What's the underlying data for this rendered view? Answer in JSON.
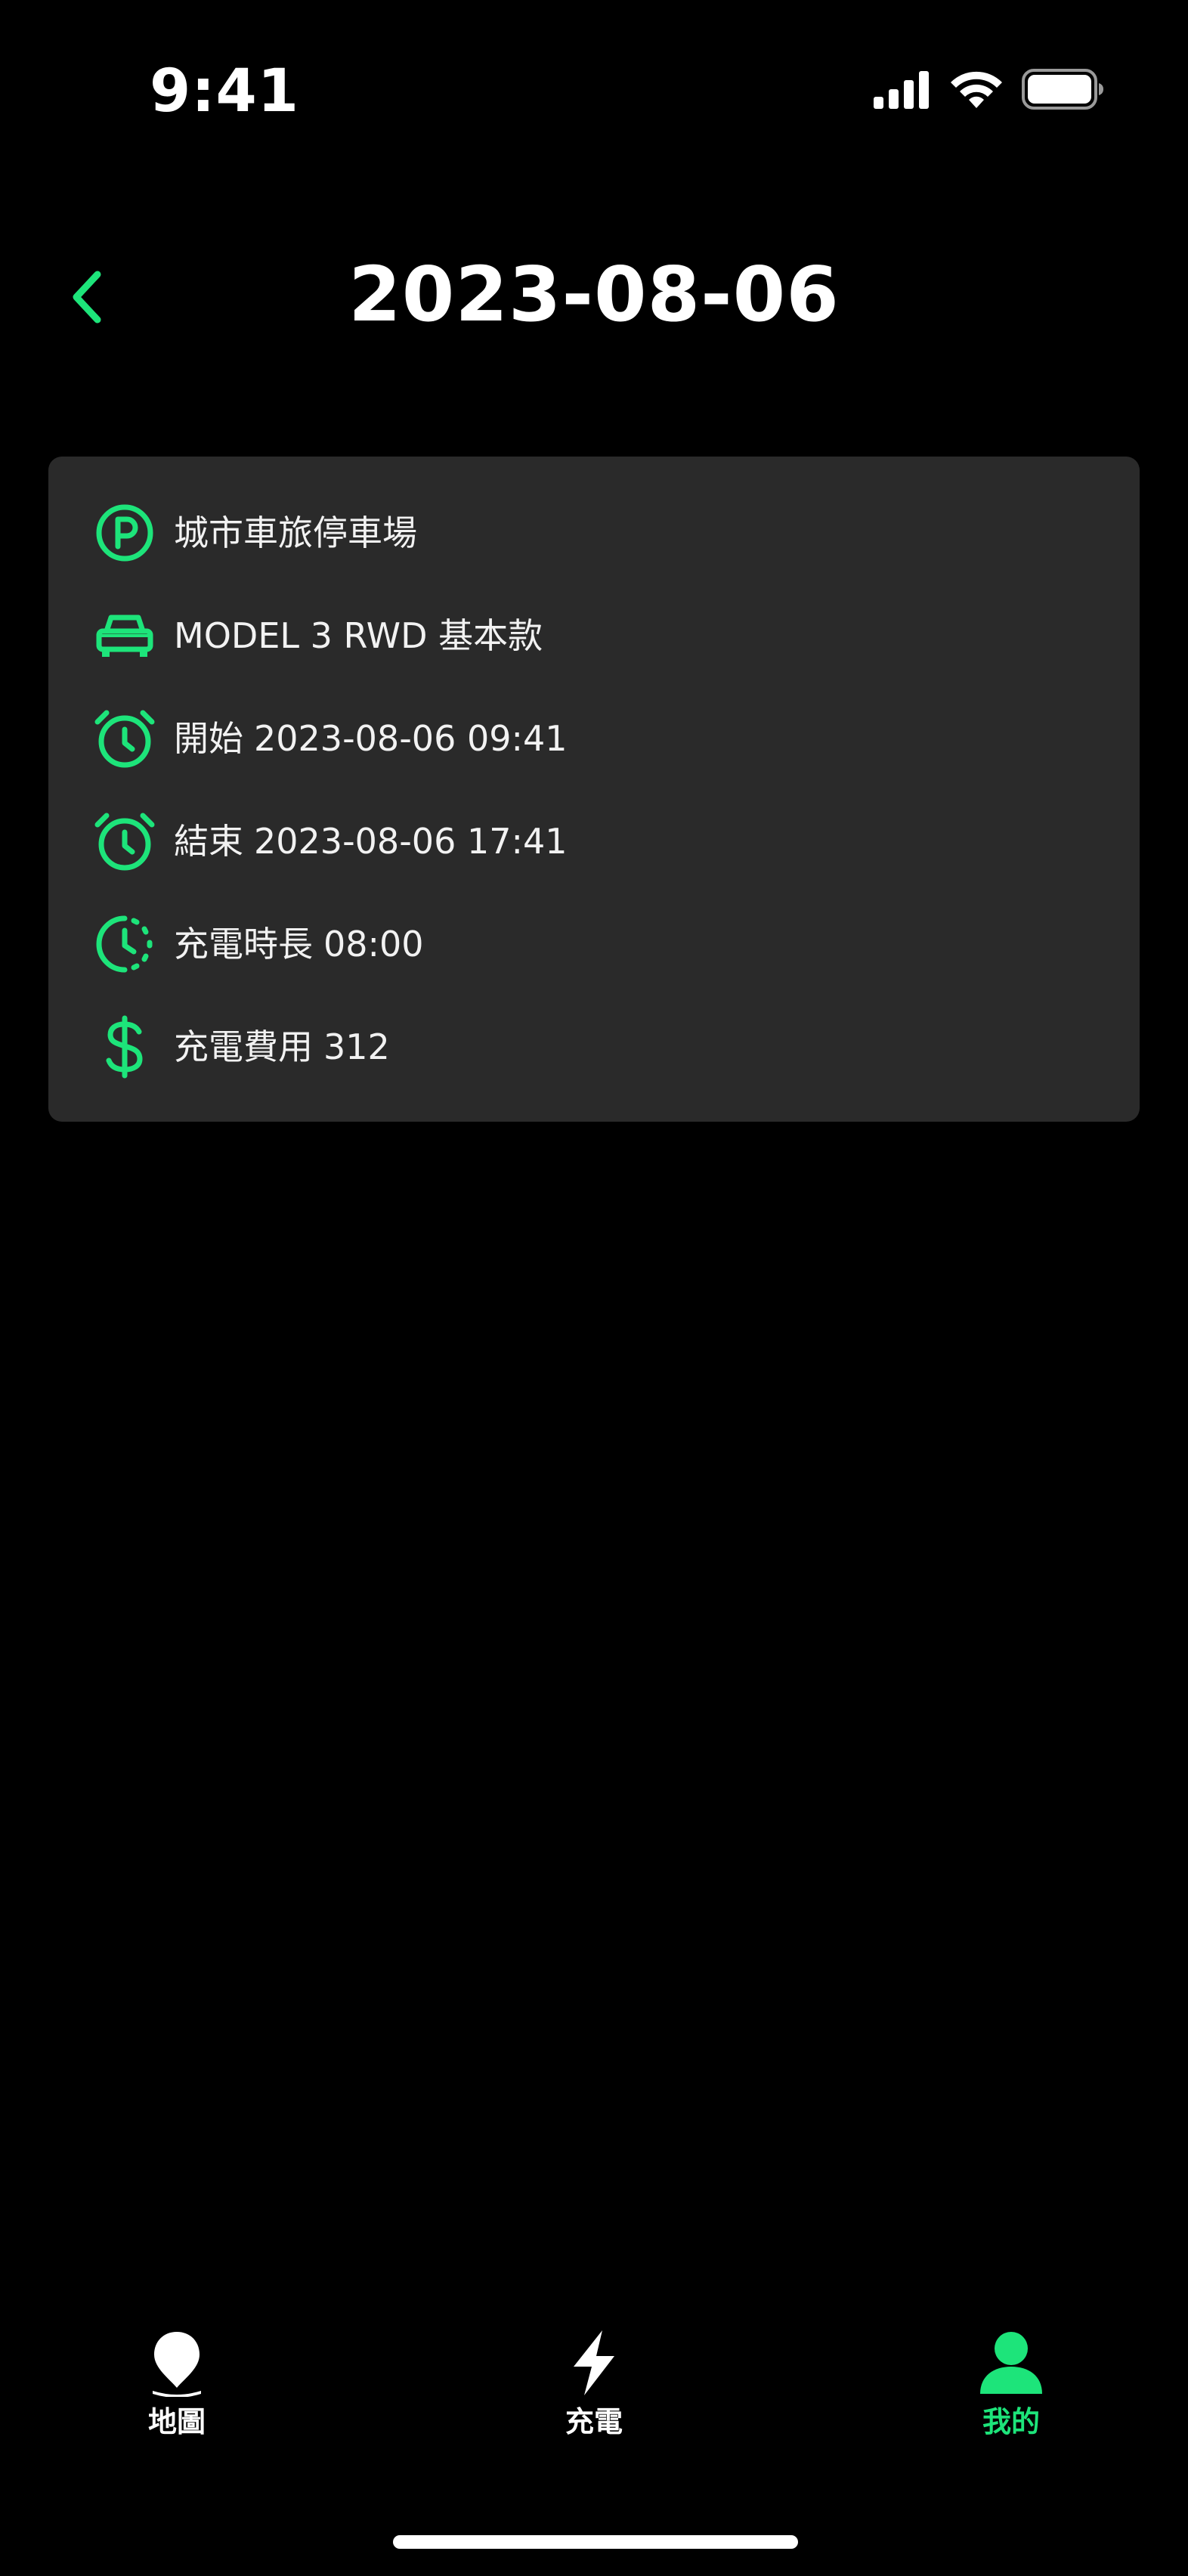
{
  "status_bar": {
    "time": "9:41"
  },
  "header": {
    "title": "2023-08-06",
    "back_icon": "chevron-left-icon"
  },
  "colors": {
    "accent": "#1de47a",
    "card_bg": "#2a2a2a",
    "background": "#000000",
    "text": "#ffffff"
  },
  "details": {
    "station": {
      "icon": "parking-icon",
      "text": "城市車旅停車場"
    },
    "vehicle": {
      "icon": "car-icon",
      "text": "MODEL 3 RWD 基本款"
    },
    "start": {
      "icon": "alarm-clock-icon",
      "label": "開始",
      "value": "2023-08-06 09:41"
    },
    "end": {
      "icon": "alarm-clock-icon",
      "label": "結束",
      "value": "2023-08-06 17:41"
    },
    "duration": {
      "icon": "clock-duration-icon",
      "label": "充電時長",
      "value": "08:00"
    },
    "cost": {
      "icon": "dollar-icon",
      "label": "充電費用",
      "value": "312"
    }
  },
  "tab_bar": {
    "tabs": [
      {
        "label": "地圖",
        "icon": "map-pin-icon",
        "active": false
      },
      {
        "label": "充電",
        "icon": "lightning-icon",
        "active": false
      },
      {
        "label": "我的",
        "icon": "user-icon",
        "active": true
      }
    ]
  }
}
